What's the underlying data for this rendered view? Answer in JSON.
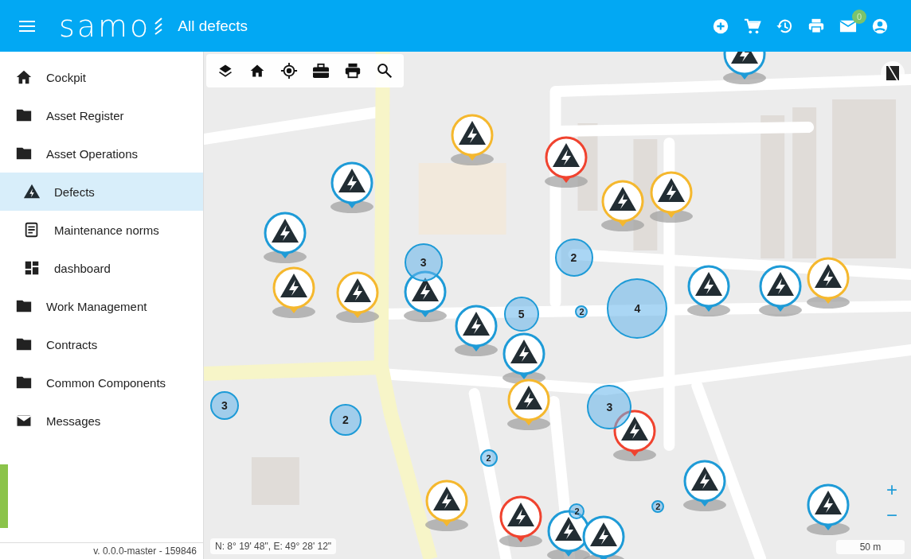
{
  "header": {
    "logo": "samo",
    "title": "All defects",
    "mail_badge": "0"
  },
  "sidebar": {
    "items": [
      {
        "label": "Cockpit",
        "selected": false
      },
      {
        "label": "Asset Register",
        "selected": false
      },
      {
        "label": "Asset Operations",
        "selected": false,
        "expanded": true,
        "children": [
          {
            "label": "Defects",
            "selected": true
          },
          {
            "label": "Maintenance norms",
            "selected": false
          },
          {
            "label": "dashboard",
            "selected": false
          }
        ]
      },
      {
        "label": "Work Management",
        "selected": false
      },
      {
        "label": "Contracts",
        "selected": false
      },
      {
        "label": "Common Components",
        "selected": false
      },
      {
        "label": "Messages",
        "selected": false
      }
    ],
    "version": "v. 0.0.0-master - 159846"
  },
  "map": {
    "coordinates": "N: 8° 19' 48\", E: 49° 28' 12\"",
    "scale": "50 m",
    "zoom_in": "+",
    "zoom_out": "−",
    "markers": [
      {
        "kind": "pin",
        "color": "#1e9bd7"
      },
      {
        "kind": "pin",
        "color": "#f5b82e"
      },
      {
        "kind": "pin",
        "color": "#f0432f"
      },
      {
        "kind": "pin",
        "color": "#1e9bd7"
      },
      {
        "kind": "pin",
        "color": "#f5b82e"
      },
      {
        "kind": "pin",
        "color": "#f5b82e"
      },
      {
        "kind": "pin",
        "color": "#1e9bd7"
      },
      {
        "kind": "pin",
        "color": "#f5b82e"
      },
      {
        "kind": "pin",
        "color": "#f5b82e"
      },
      {
        "kind": "pin",
        "color": "#1e9bd7"
      },
      {
        "kind": "pin",
        "color": "#1e9bd7"
      },
      {
        "kind": "pin",
        "color": "#1e9bd7"
      },
      {
        "kind": "pin",
        "color": "#1e9bd7"
      },
      {
        "kind": "pin",
        "color": "#f5b82e"
      },
      {
        "kind": "pin",
        "color": "#1e9bd7"
      },
      {
        "kind": "pin",
        "color": "#f5b82e"
      },
      {
        "kind": "pin",
        "color": "#f0432f"
      },
      {
        "kind": "pin",
        "color": "#1e9bd7"
      },
      {
        "kind": "pin",
        "color": "#1e9bd7"
      },
      {
        "kind": "pin",
        "color": "#f5b82e"
      },
      {
        "kind": "pin",
        "color": "#f0432f"
      },
      {
        "kind": "pin",
        "color": "#1e9bd7"
      },
      {
        "kind": "pin",
        "color": "#1e9bd7"
      },
      {
        "kind": "cluster",
        "count": "3"
      },
      {
        "kind": "cluster",
        "count": "2"
      },
      {
        "kind": "cluster",
        "count": "5"
      },
      {
        "kind": "cluster",
        "count": "2"
      },
      {
        "kind": "cluster",
        "count": "4"
      },
      {
        "kind": "cluster",
        "count": "2"
      },
      {
        "kind": "cluster",
        "count": "3"
      },
      {
        "kind": "cluster",
        "count": "3"
      },
      {
        "kind": "cluster",
        "count": "2"
      },
      {
        "kind": "cluster",
        "count": "2"
      },
      {
        "kind": "cluster",
        "count": "2"
      }
    ]
  }
}
